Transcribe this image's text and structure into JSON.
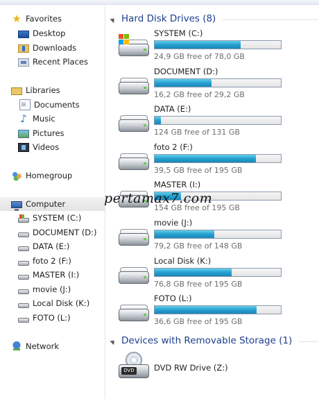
{
  "nav": {
    "favorites": {
      "label": "Favorites",
      "icon": "star-icon"
    },
    "favorite_items": [
      {
        "label": "Desktop",
        "icon": "desktop-icon"
      },
      {
        "label": "Downloads",
        "icon": "downloads-icon"
      },
      {
        "label": "Recent Places",
        "icon": "recent-places-icon"
      }
    ],
    "libraries": {
      "label": "Libraries",
      "icon": "libraries-icon"
    },
    "library_items": [
      {
        "label": "Documents",
        "icon": "document-icon"
      },
      {
        "label": "Music",
        "icon": "music-icon"
      },
      {
        "label": "Pictures",
        "icon": "pictures-icon"
      },
      {
        "label": "Videos",
        "icon": "videos-icon"
      }
    ],
    "homegroup": {
      "label": "Homegroup",
      "icon": "homegroup-icon"
    },
    "computer": {
      "label": "Computer",
      "icon": "computer-icon",
      "selected": true
    },
    "computer_items": [
      {
        "label": "SYSTEM (C:)",
        "icon": "system-drive-icon"
      },
      {
        "label": "DOCUMENT (D:)",
        "icon": "drive-icon"
      },
      {
        "label": "DATA (E:)",
        "icon": "drive-icon"
      },
      {
        "label": "foto 2 (F:)",
        "icon": "drive-icon"
      },
      {
        "label": "MASTER (I:)",
        "icon": "drive-icon"
      },
      {
        "label": "movie (J:)",
        "icon": "drive-icon"
      },
      {
        "label": "Local Disk (K:)",
        "icon": "drive-icon"
      },
      {
        "label": "FOTO (L:)",
        "icon": "drive-icon"
      }
    ],
    "network": {
      "label": "Network",
      "icon": "network-icon"
    }
  },
  "content": {
    "hard_disk_group": {
      "title": "Hard Disk Drives (8)"
    },
    "drives": [
      {
        "name": "SYSTEM (C:)",
        "free_text": "24,9 GB free of 78,0 GB",
        "used_fraction": 0.68,
        "system": true
      },
      {
        "name": "DOCUMENT (D:)",
        "free_text": "16,2 GB free of 29,2 GB",
        "used_fraction": 0.45
      },
      {
        "name": "DATA (E:)",
        "free_text": "124 GB free of 131 GB",
        "used_fraction": 0.05
      },
      {
        "name": "foto 2 (F:)",
        "free_text": "39,5 GB free of 195 GB",
        "used_fraction": 0.8
      },
      {
        "name": "MASTER (I:)",
        "free_text": "154 GB free of 195 GB",
        "used_fraction": 0.21
      },
      {
        "name": "movie (J:)",
        "free_text": "79,2 GB free of 148 GB",
        "used_fraction": 0.47
      },
      {
        "name": "Local Disk (K:)",
        "free_text": "76,8 GB free of 195 GB",
        "used_fraction": 0.61
      },
      {
        "name": "FOTO (L:)",
        "free_text": "36,6 GB free of 195 GB",
        "used_fraction": 0.81
      }
    ],
    "removable_group": {
      "title": "Devices with Removable Storage (1)"
    },
    "removable": [
      {
        "name": "DVD RW Drive (Z:)",
        "badge": "DVD",
        "icon": "dvd-drive-icon"
      }
    ]
  },
  "watermark": "pertamax7.com",
  "colors": {
    "bar_fill": "#26a0d0",
    "group_title": "#1d3e8e",
    "free_text": "#6d6d6d"
  }
}
